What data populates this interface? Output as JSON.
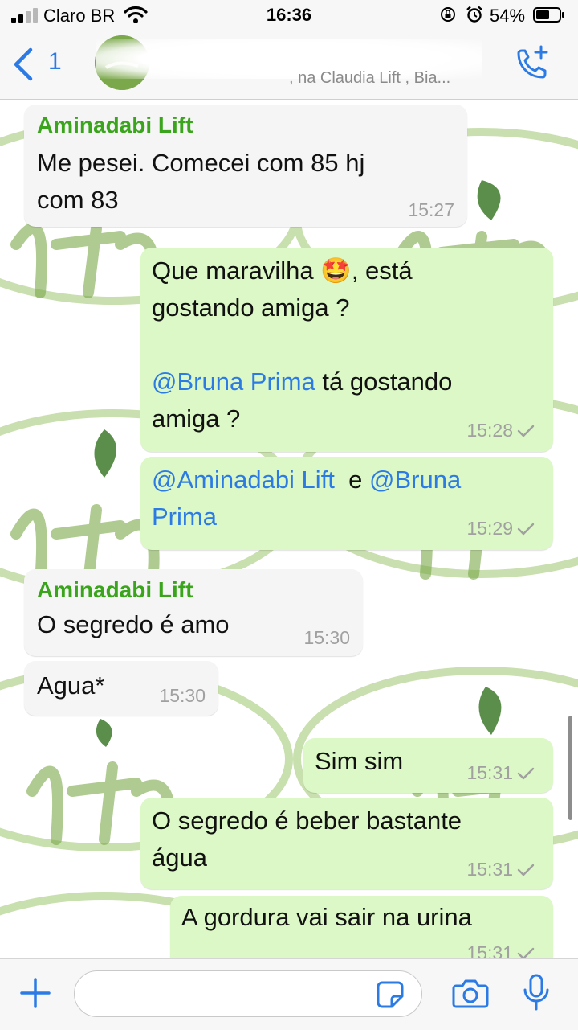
{
  "status_bar": {
    "carrier": "Claro BR",
    "time": "16:36",
    "battery": "54%",
    "icons": [
      "signal-icon",
      "wifi-icon",
      "orientation-lock-icon",
      "alarm-icon",
      "battery-icon"
    ]
  },
  "header": {
    "back_count": "1",
    "members_subtitle": ", na Claudia Lift , Bia...",
    "icons": [
      "back-chevron-icon",
      "group-avatar",
      "add-call-icon"
    ]
  },
  "messages": [
    {
      "direction": "in",
      "sender": "Aminadabi Lift",
      "lines": [
        "Me pesei. Comecei com 85 hj",
        "com 83"
      ],
      "time": "15:27"
    },
    {
      "direction": "out",
      "line1_before_emoji": "Que maravilha ",
      "emoji": "🤩",
      "line1_after_emoji": ", está",
      "line2": "gostando amiga ?",
      "mention": "@Bruna Prima",
      "line3_after_mention": "  tá gostando",
      "line4": "amiga ?",
      "time": "15:28"
    },
    {
      "direction": "out",
      "mention1": "@Aminadabi Lift",
      "joiner": "  e ",
      "mention2_part1": "@Bruna",
      "mention2_part2": "Prima",
      "time": "15:29"
    },
    {
      "direction": "in",
      "sender": "Aminadabi Lift",
      "lines": [
        "O segredo é amo"
      ],
      "time": "15:30"
    },
    {
      "direction": "in",
      "lines": [
        "Agua*"
      ],
      "time": "15:30"
    },
    {
      "direction": "out",
      "lines": [
        "Sim sim"
      ],
      "time": "15:31"
    },
    {
      "direction": "out",
      "lines": [
        "O segredo é beber bastante",
        "água"
      ],
      "time": "15:31"
    },
    {
      "direction": "out",
      "lines": [
        "A gordura vai sair na urina"
      ],
      "time": "15:31"
    }
  ],
  "composer": {
    "placeholder": "",
    "icons": [
      "plus-icon",
      "sticker-icon",
      "camera-icon",
      "microphone-icon"
    ]
  },
  "colors": {
    "accent_blue": "#2c7be5",
    "sender_green": "#3aa51c",
    "outgoing_bubble": "#dcf8c6",
    "incoming_bubble": "#f5f5f5",
    "wallpaper_green": "#7aa84a"
  }
}
